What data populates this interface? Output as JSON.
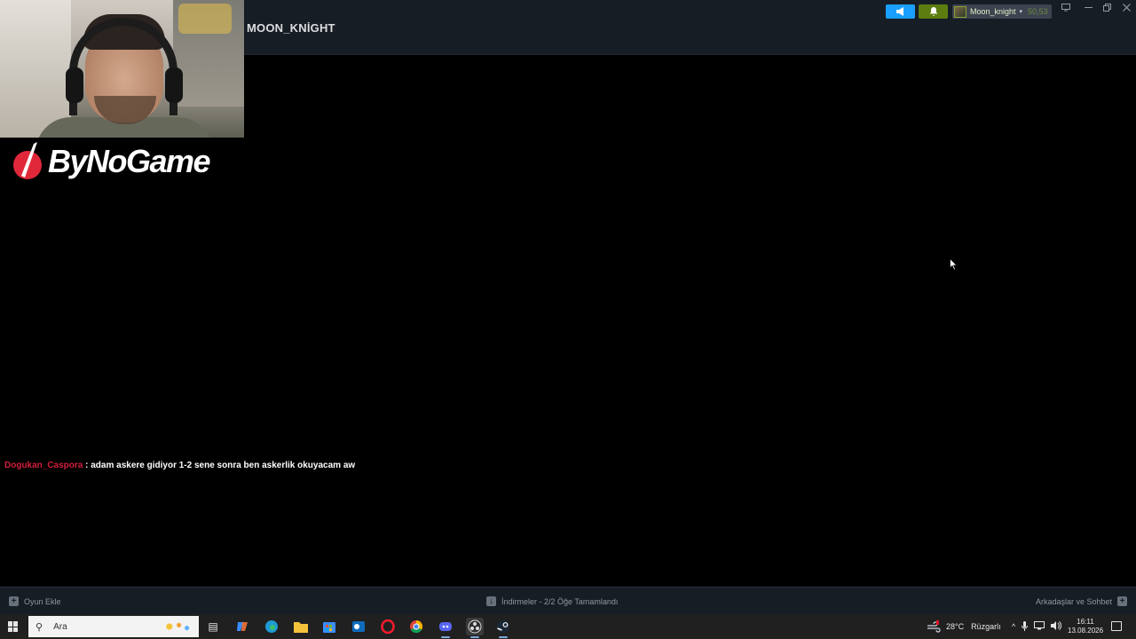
{
  "steam": {
    "page_title": "MOON_KNİGHT",
    "account": {
      "name": "Moon_knight",
      "balance": "50,53"
    },
    "bottom_bar": {
      "add_game": "Oyun Ekle",
      "downloads": "İndirmeler - 2/2 Öğe Tamamlandı",
      "friends_chat": "Arkadaşlar ve Sohbet"
    }
  },
  "overlay": {
    "brand": "ByNoGame",
    "chat": {
      "user": "Dogukan_Caspora",
      "message": " : adam askere gidiyor 1-2 sene sonra ben askerlik okuyacam aw"
    }
  },
  "taskbar": {
    "search_placeholder": "Ara",
    "weather": {
      "temp": "28°C",
      "condition": "Rüzgarlı"
    },
    "clock": {
      "time": "16:11",
      "date": "13.08.2026"
    },
    "apps": [
      "task-view",
      "copilot",
      "edge",
      "file-explorer",
      "microsoft-store",
      "outlook",
      "opera",
      "chrome",
      "discord",
      "obs",
      "steam"
    ]
  },
  "colors": {
    "steam_bg": "#171d25",
    "announce": "#1a9fff",
    "notification": "#5c7e10",
    "chat_user": "#d21f3c",
    "taskbar": "#202020"
  }
}
